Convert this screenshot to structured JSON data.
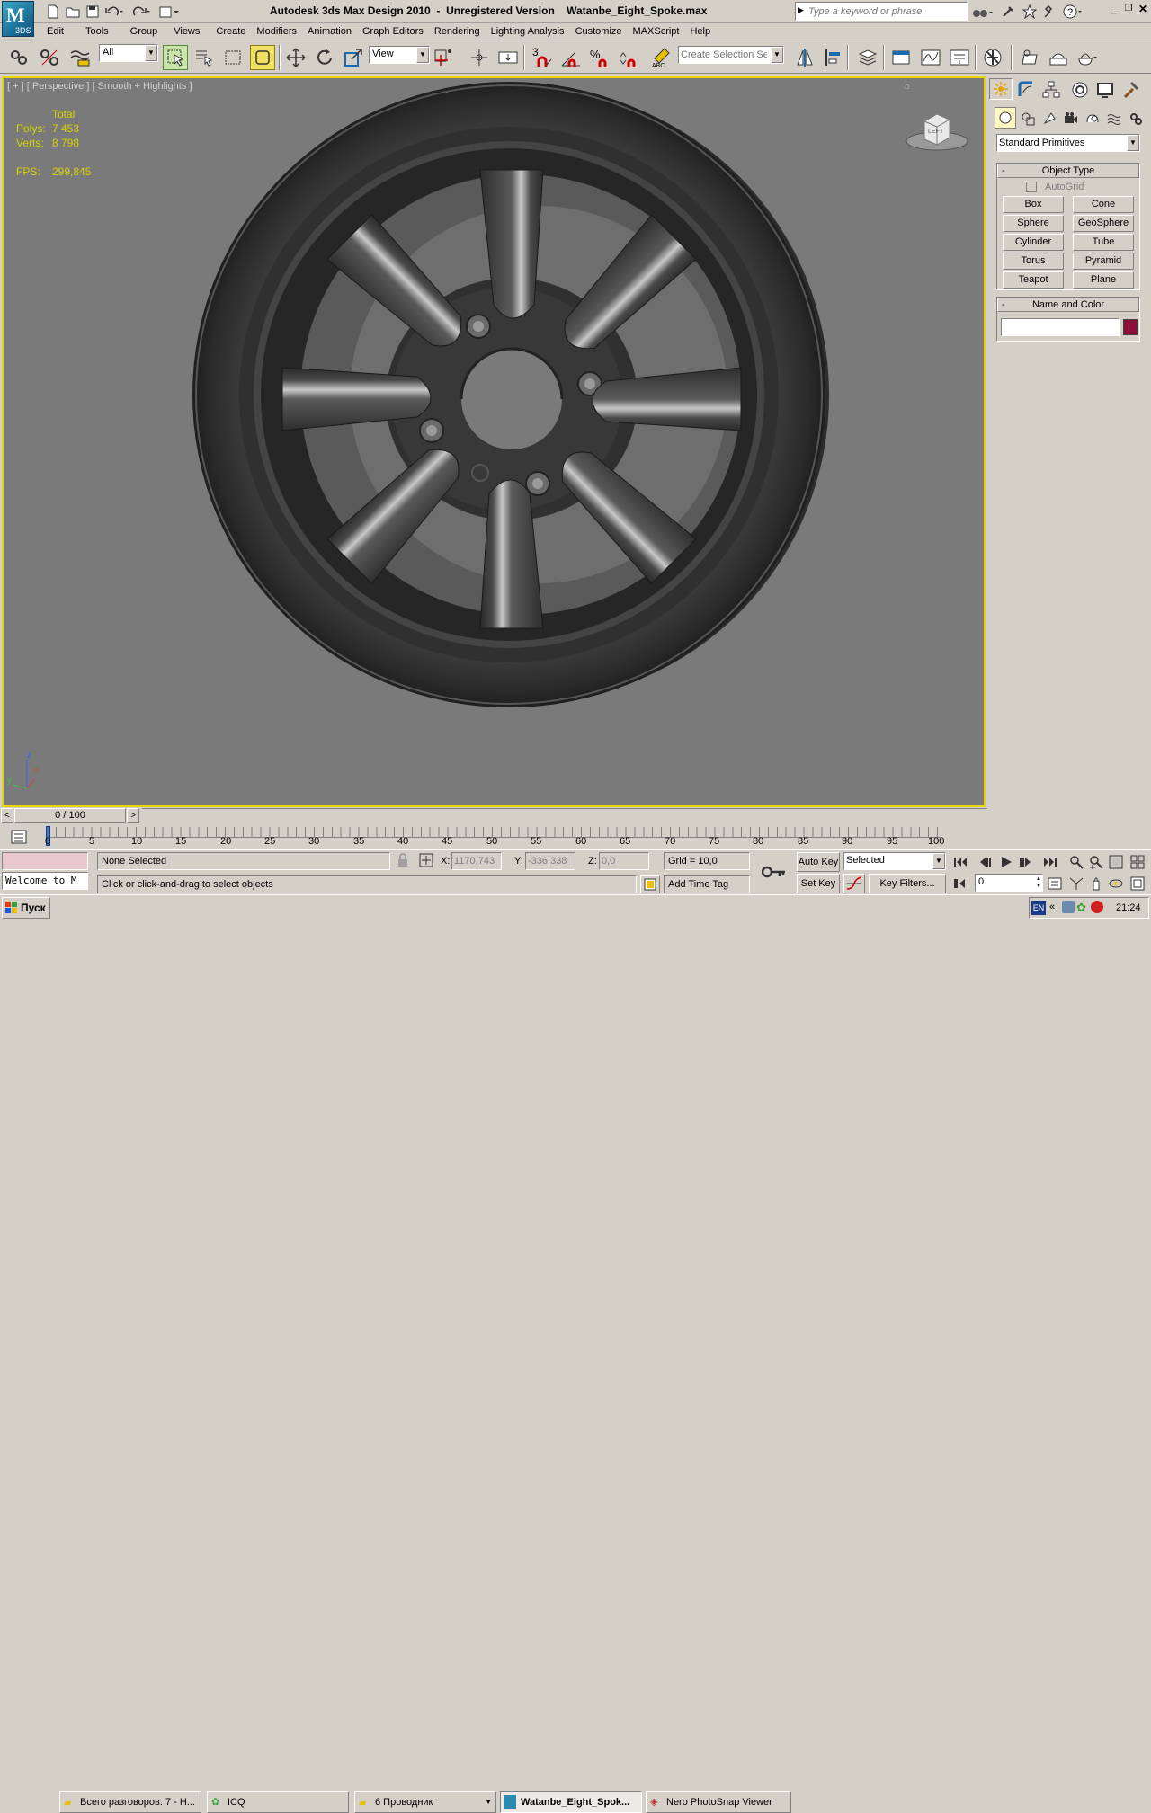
{
  "app": {
    "title": "Autodesk 3ds Max Design 2010  -  Unregistered Version    Watanbe_Eight_Spoke.max",
    "logo_label": "3DS",
    "search_placeholder": "Type a keyword or phrase"
  },
  "menu": [
    "Edit",
    "Tools",
    "Group",
    "Views",
    "Create",
    "Modifiers",
    "Animation",
    "Graph Editors",
    "Rendering",
    "Lighting Analysis",
    "Customize",
    "MAXScript",
    "Help"
  ],
  "toolbar": {
    "filter_value": "All",
    "refcoord_value": "View",
    "snap_label": "3",
    "selection_set_placeholder": "Create Selection Se"
  },
  "viewport": {
    "label": "[ + ] [ Perspective ] [ Smooth + Highlights ]",
    "stats": {
      "header": "Total",
      "polys_label": "Polys:",
      "polys_value": "7 453",
      "verts_label": "Verts:",
      "verts_value": "8 798",
      "fps_label": "FPS:",
      "fps_value": "299,845"
    },
    "viewcube_label": "LEFT",
    "axis": {
      "z": "z",
      "x": "x",
      "y": "y"
    }
  },
  "command_panel": {
    "dropdown": "Standard Primitives",
    "object_type": {
      "title": "Object Type",
      "autogrid": "AutoGrid",
      "buttons": [
        "Box",
        "Cone",
        "Sphere",
        "GeoSphere",
        "Cylinder",
        "Tube",
        "Torus",
        "Pyramid",
        "Teapot",
        "Plane"
      ]
    },
    "name_color": {
      "title": "Name and Color",
      "name_value": "",
      "color": "#8b0f3a"
    }
  },
  "timeline": {
    "slider": "0 / 100",
    "ticks": [
      "0",
      "5",
      "10",
      "15",
      "20",
      "25",
      "30",
      "35",
      "40",
      "45",
      "50",
      "55",
      "60",
      "65",
      "70",
      "75",
      "80",
      "85",
      "90",
      "95",
      "100"
    ]
  },
  "status": {
    "maxscript_text": "Welcome to M",
    "selection": "None Selected",
    "prompt": "Click or click-and-drag to select objects",
    "x_label": "X:",
    "x_value": "1170,743",
    "y_label": "Y:",
    "y_value": "-336,338",
    "z_label": "Z:",
    "z_value": "0,0",
    "grid": "Grid = 10,0",
    "add_time_tag": "Add Time Tag",
    "auto_key": "Auto Key",
    "set_key": "Set Key",
    "key_mode": "Selected",
    "key_filters": "Key Filters...",
    "frame": "0"
  },
  "taskbar": {
    "start": "Пуск",
    "tasks": [
      "Всего разговоров: 7 - Н...",
      "ICQ",
      "6 Проводник",
      "Watanbe_Eight_Spok...",
      "Nero PhotoSnap Viewer"
    ],
    "lang": "EN",
    "clock": "21:24"
  }
}
